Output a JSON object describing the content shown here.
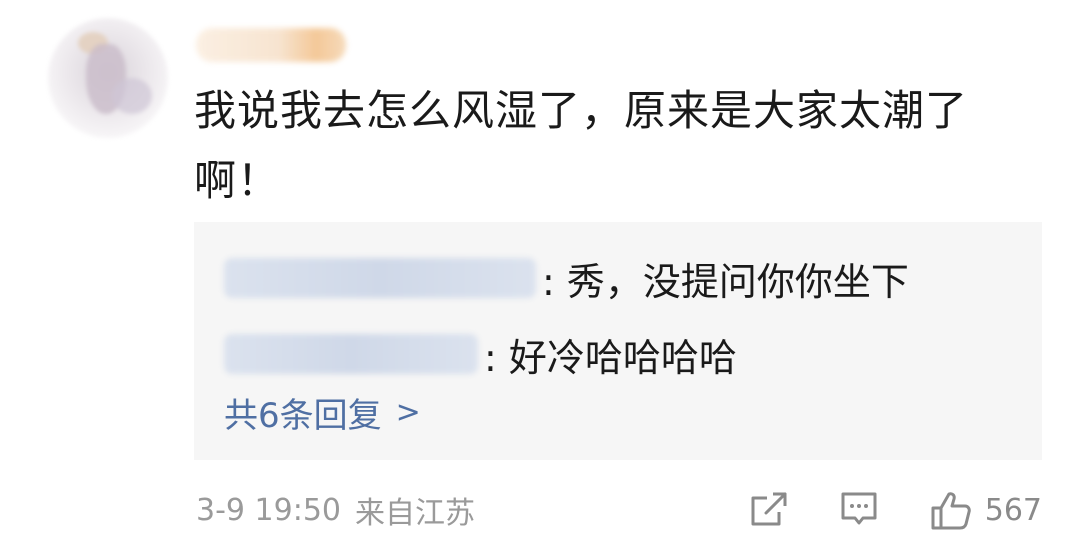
{
  "comment": {
    "avatar_icon": "user-avatar",
    "username_icon": "blurred-username",
    "text": "我说我去怎么风湿了，原来是大家太潮了啊！"
  },
  "replies": [
    {
      "text": ": 秀，没提问你你坐下"
    },
    {
      "text": ": 好冷哈哈哈哈"
    }
  ],
  "more_replies_label": "共6条回复",
  "more_replies_chevron": ">",
  "footer": {
    "time": "3-9 19:50",
    "location": "来自江苏"
  },
  "actions": {
    "share_icon": "share-icon",
    "comment_icon": "comment-icon",
    "like_icon": "thumbs-up-icon",
    "like_count": "567"
  },
  "colors": {
    "link": "#4f6fa3",
    "meta": "#9a9a9a",
    "reply_bg": "#f6f6f6"
  }
}
